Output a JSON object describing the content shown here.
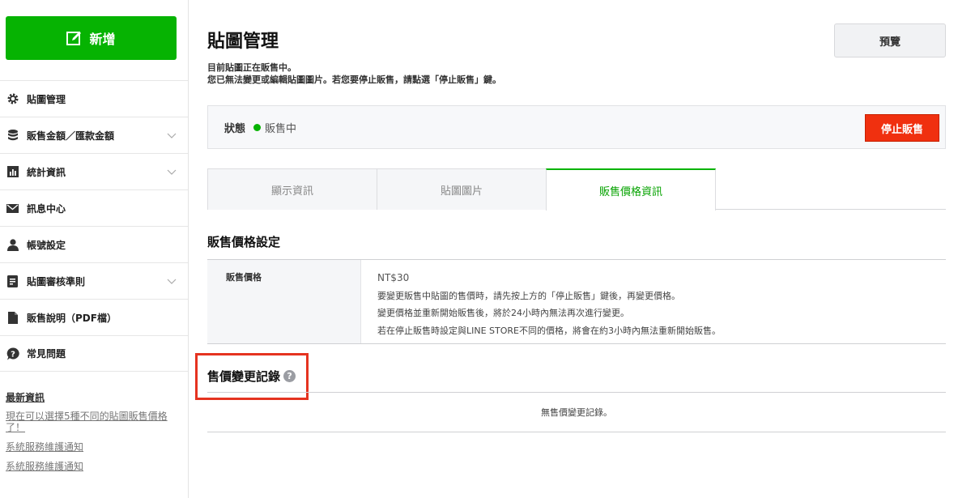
{
  "sidebar": {
    "new_button": "新增",
    "items": [
      {
        "label": "貼圖管理",
        "icon": "gear-icon",
        "chevron": false
      },
      {
        "label": "販售金額／匯款金額",
        "icon": "coins-icon",
        "chevron": true
      },
      {
        "label": "統計資訊",
        "icon": "bar-chart-icon",
        "chevron": true
      },
      {
        "label": "訊息中心",
        "icon": "envelope-icon",
        "chevron": false
      },
      {
        "label": "帳號設定",
        "icon": "user-icon",
        "chevron": false
      },
      {
        "label": "貼圖審核準則",
        "icon": "document-icon",
        "chevron": true
      },
      {
        "label": "販售說明（PDF檔）",
        "icon": "file-icon",
        "chevron": false
      },
      {
        "label": "常見問題",
        "icon": "question-icon",
        "chevron": false
      }
    ],
    "news": {
      "title": "最新資訊",
      "links": [
        "現在可以選擇5種不同的貼圖販售價格了！",
        "系統服務維護通知",
        "系統服務維護通知"
      ]
    }
  },
  "header": {
    "title": "貼圖管理",
    "preview_button": "預覽",
    "desc_line1": "目前貼圖正在販售中。",
    "desc_line2": "您已無法變更或編輯貼圖圖片。若您要停止販售，請點選「停止販售」鍵。"
  },
  "status": {
    "label": "狀態",
    "value": "販售中",
    "dot_color": "#06b302",
    "stop_button": "停止販售"
  },
  "tabs": [
    {
      "label": "顯示資訊",
      "active": false
    },
    {
      "label": "貼圖圖片",
      "active": false
    },
    {
      "label": "販售價格資訊",
      "active": true
    }
  ],
  "price_section": {
    "title": "販售價格設定",
    "row_label": "販售價格",
    "price": "NT$30",
    "notes": [
      "要變更販售中貼圖的售價時，請先按上方的「停止販售」鍵後，再變更價格。",
      "變更價格並重新開始販售後，將於24小時內無法再次進行變更。",
      "若在停止販售時設定與LINE STORE不同的價格，將會在約3小時內無法重新開始販售。"
    ]
  },
  "history": {
    "title": "售價變更記錄",
    "help": "?",
    "empty_text": "無售價變更記錄。"
  },
  "colors": {
    "brand_green": "#06b302",
    "stop_red": "#f0300f",
    "highlight_red": "#e53320"
  }
}
